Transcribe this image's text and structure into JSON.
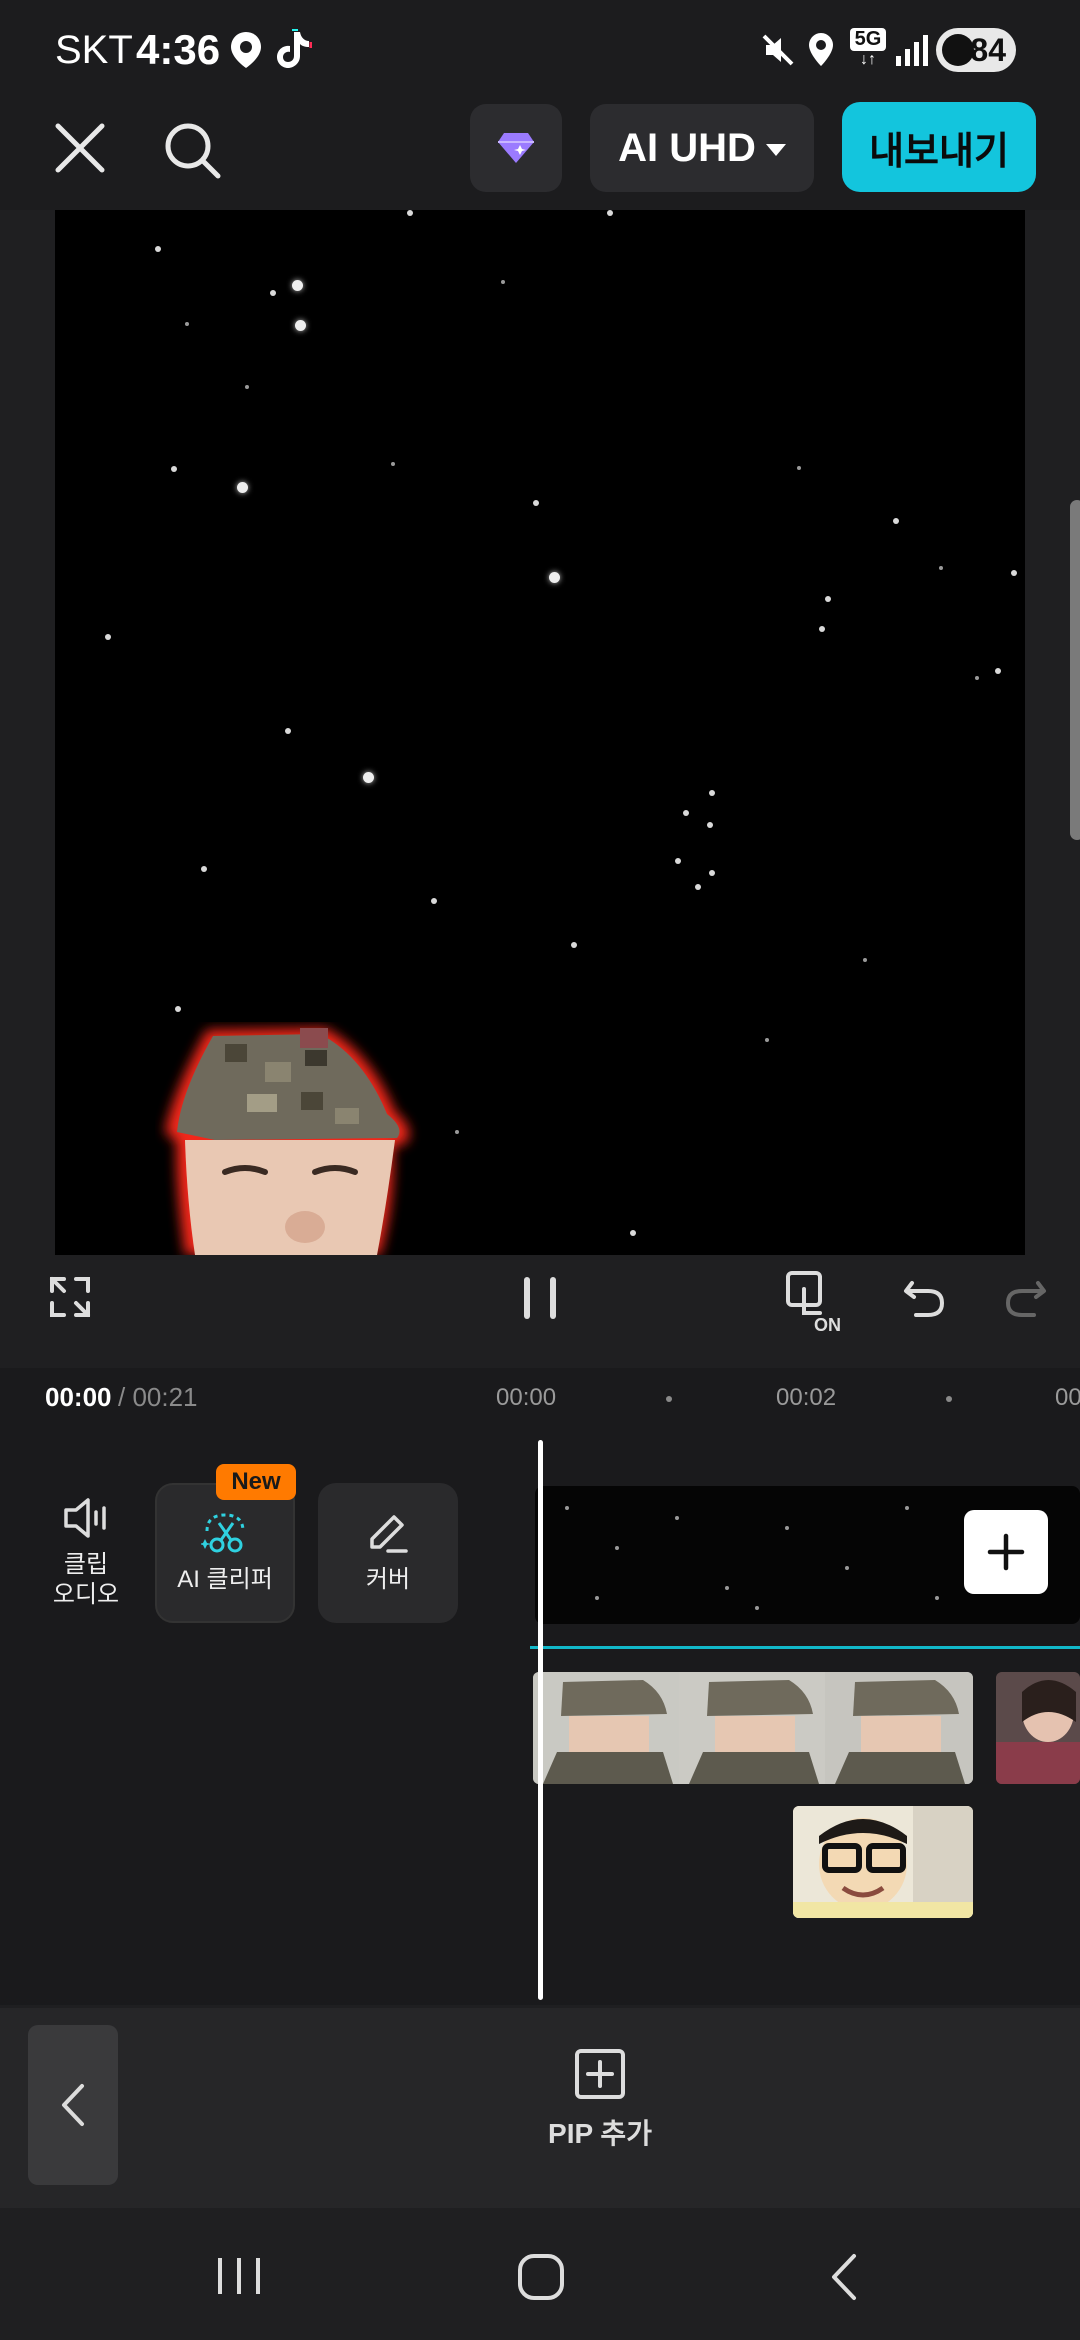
{
  "status_bar": {
    "carrier": "SKT",
    "time": "4:36",
    "network": "5G",
    "battery": "84"
  },
  "toolbar": {
    "quality_label": "AI UHD",
    "export_label": "내보내기"
  },
  "timeline": {
    "current_time": "00:00",
    "total_time": "/ 00:21",
    "ticks": [
      "00:00",
      "00:02",
      "00"
    ]
  },
  "tools": {
    "audio_label": "클립\n오디오",
    "aiclip_label": "AI 클리퍼",
    "new_badge": "New",
    "cover_label": "커버"
  },
  "action_bar": {
    "pip_label": "PIP 추가"
  },
  "colors": {
    "accent": "#13c5dd",
    "badge": "#ff7a00",
    "track_line": "#12b8c9"
  }
}
